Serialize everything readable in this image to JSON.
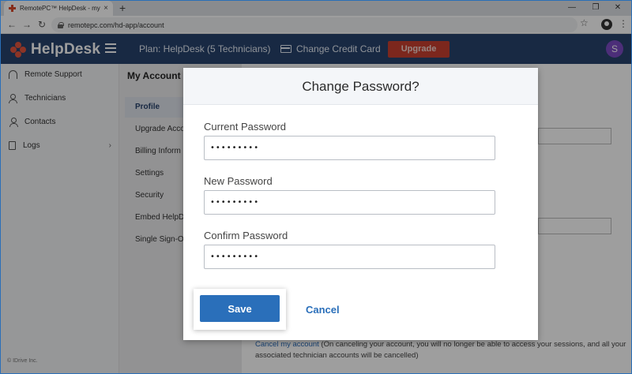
{
  "browser": {
    "tab_title": "RemotePC™ HelpDesk - my acco",
    "tab_close": "×",
    "new_tab": "+",
    "url": "remotepc.com/hd-app/account",
    "minimize": "—",
    "restore": "❐",
    "close": "✕",
    "back": "←",
    "forward": "→",
    "reload": "↻",
    "bookmark": "☆",
    "menu": "⋮"
  },
  "header": {
    "brand": "HelpDesk",
    "plan": "Plan: HelpDesk (5 Technicians)",
    "change_card": "Change Credit Card",
    "upgrade": "Upgrade",
    "avatar_letter": "S"
  },
  "sidebar": {
    "items": [
      {
        "label": "Remote Support",
        "icon": "headset-icon"
      },
      {
        "label": "Technicians",
        "icon": "technicians-icon"
      },
      {
        "label": "Contacts",
        "icon": "contact-icon"
      },
      {
        "label": "Logs",
        "icon": "logs-icon"
      }
    ],
    "logs_chevron": "›",
    "copyright": "© IDrive Inc."
  },
  "account_nav": {
    "title": "My Account",
    "items": [
      "Profile",
      "Upgrade Acco",
      "Billing Inform",
      "Settings",
      "Security",
      "Embed HelpD",
      "Single Sign-O"
    ]
  },
  "cancel_account": {
    "link": "Cancel my account",
    "text": " (On canceling your account, you will no longer be able to access your sessions, and all your associated technician accounts will be cancelled)"
  },
  "modal": {
    "title": "Change Password?",
    "current_label": "Current Password",
    "current_value": "•••••••••",
    "new_label": "New Password",
    "new_value": "•••••••••",
    "confirm_label": "Confirm Password",
    "confirm_value": "•••••••••",
    "save": "Save",
    "cancel": "Cancel"
  },
  "colors": {
    "header_bg": "#28436c",
    "upgrade_bg": "#c9402f",
    "primary": "#2a6fba",
    "avatar_bg": "#7b4bc4"
  }
}
